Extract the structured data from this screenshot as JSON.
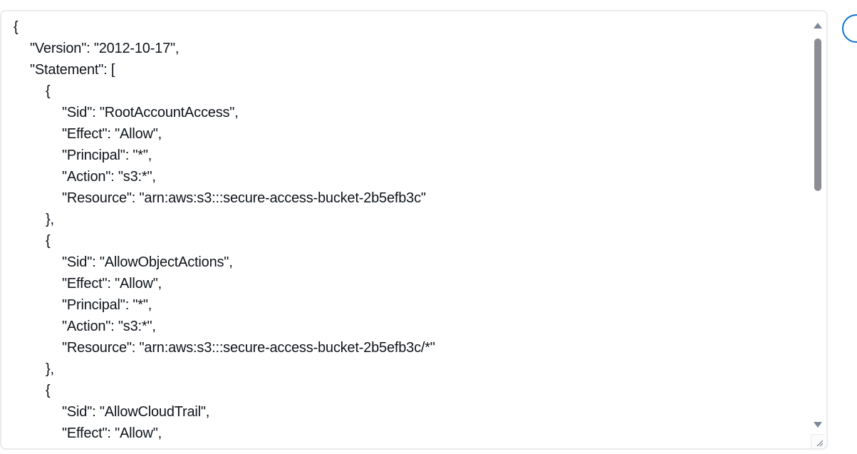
{
  "editor": {
    "lines": [
      {
        "indent": 0,
        "text": "{"
      },
      {
        "indent": 1,
        "text": "\"Version\": \"2012-10-17\","
      },
      {
        "indent": 1,
        "text": "\"Statement\": ["
      },
      {
        "indent": 2,
        "text": "{"
      },
      {
        "indent": 3,
        "text": "\"Sid\": \"RootAccountAccess\","
      },
      {
        "indent": 3,
        "text": "\"Effect\": \"Allow\","
      },
      {
        "indent": 3,
        "text": "\"Principal\": \"*\","
      },
      {
        "indent": 3,
        "text": "\"Action\": \"s3:*\","
      },
      {
        "indent": 3,
        "text": "\"Resource\": \"arn:aws:s3:::secure-access-bucket-2b5efb3c\""
      },
      {
        "indent": 2,
        "text": "},"
      },
      {
        "indent": 2,
        "text": "{"
      },
      {
        "indent": 3,
        "text": "\"Sid\": \"AllowObjectActions\","
      },
      {
        "indent": 3,
        "text": "\"Effect\": \"Allow\","
      },
      {
        "indent": 3,
        "text": "\"Principal\": \"*\","
      },
      {
        "indent": 3,
        "text": "\"Action\": \"s3:*\","
      },
      {
        "indent": 3,
        "text": "\"Resource\": \"arn:aws:s3:::secure-access-bucket-2b5efb3c/*\""
      },
      {
        "indent": 2,
        "text": "},"
      },
      {
        "indent": 2,
        "text": "{"
      },
      {
        "indent": 3,
        "text": "\"Sid\": \"AllowCloudTrail\","
      },
      {
        "indent": 3,
        "text": "\"Effect\": \"Allow\","
      }
    ]
  },
  "icons": {
    "scroll_up": "arrow-up-icon",
    "scroll_down": "arrow-down-icon",
    "resize": "resize-grip-icon",
    "help": "help-icon"
  },
  "colors": {
    "text": "#0f141a",
    "border": "#e9ebed",
    "accent": "#0972d3",
    "scroll_thumb": "#8c8c94"
  }
}
